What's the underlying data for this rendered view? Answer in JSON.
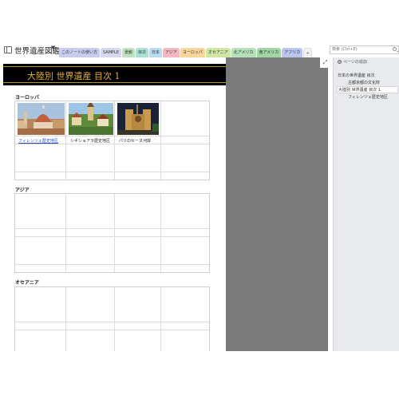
{
  "notebook": {
    "title": "世界遺産図鑑"
  },
  "tabs": [
    {
      "label": "このノートの使い方",
      "color": "#c8cdf0"
    },
    {
      "label": "SAMPLE",
      "color": "#d6d9ee"
    },
    {
      "label": "景観",
      "color": "#bfe3c0"
    },
    {
      "label": "目次",
      "color": "#a9e0d6"
    },
    {
      "label": "日本",
      "color": "#b8dbee"
    },
    {
      "label": "アジア",
      "color": "#f4b6c2"
    },
    {
      "label": "ヨーロッパ",
      "color": "#f8d59a"
    },
    {
      "label": "オセアニア",
      "color": "#cfe6a6"
    },
    {
      "label": "北アメリカ",
      "color": "#b3e0b8"
    },
    {
      "label": "南アメリカ",
      "color": "#9fd6a4"
    },
    {
      "label": "アフリカ",
      "color": "#b9c5ee"
    },
    {
      "label": "+",
      "color": "#f1f1f1"
    }
  ],
  "search": {
    "placeholder": "検索 (Ctrl+E)"
  },
  "page": {
    "title": "大陸別 世界遺産 目次 1"
  },
  "sections": [
    {
      "label": "ヨーロッパ",
      "items": [
        {
          "caption": "フィレンツェ歴史地区",
          "link": true
        },
        {
          "caption": "シギショアラ歴史地区",
          "link": false
        },
        {
          "caption": "パリのセーヌ河岸",
          "link": false
        }
      ]
    },
    {
      "label": "アジア",
      "items": []
    },
    {
      "label": "オセアニア",
      "items": []
    }
  ],
  "sidebar": {
    "add_page": "ページの追加",
    "pages": [
      {
        "label": "日本の世界遺産 目次",
        "level": 0,
        "active": false
      },
      {
        "label": "古都京都の文化財",
        "level": 1,
        "active": false
      },
      {
        "label": "大陸別 世界遺産 目次 1",
        "level": 0,
        "active": true
      },
      {
        "label": "フィレンツェ歴史地区",
        "level": 1,
        "active": false
      }
    ]
  },
  "icons": {
    "expand": "expand-arrows-icon",
    "notebook": "notebook-icon",
    "search": "search-icon",
    "add_page": "add-page-icon"
  }
}
